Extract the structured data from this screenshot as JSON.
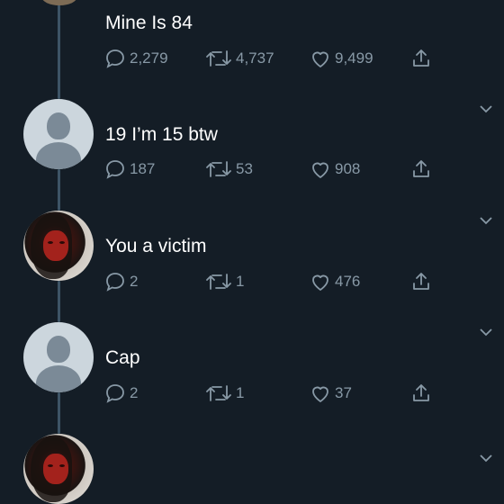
{
  "tweets": [
    {
      "text": "Mine Is 84",
      "replies": "2,279",
      "retweets": "4,737",
      "likes": "9,499"
    },
    {
      "text": "19 I’m 15 btw",
      "replies": "187",
      "retweets": "53",
      "likes": "908"
    },
    {
      "text": "You a victim",
      "replies": "2",
      "retweets": "1",
      "likes": "476"
    },
    {
      "text": "Cap",
      "replies": "2",
      "retweets": "1",
      "likes": "37"
    }
  ],
  "colors": {
    "background": "#141d26",
    "muted": "#8899a6",
    "thread": "#3d5466"
  },
  "icons": [
    "reply-icon",
    "retweet-icon",
    "like-icon",
    "share-icon",
    "chevron-down-icon"
  ]
}
